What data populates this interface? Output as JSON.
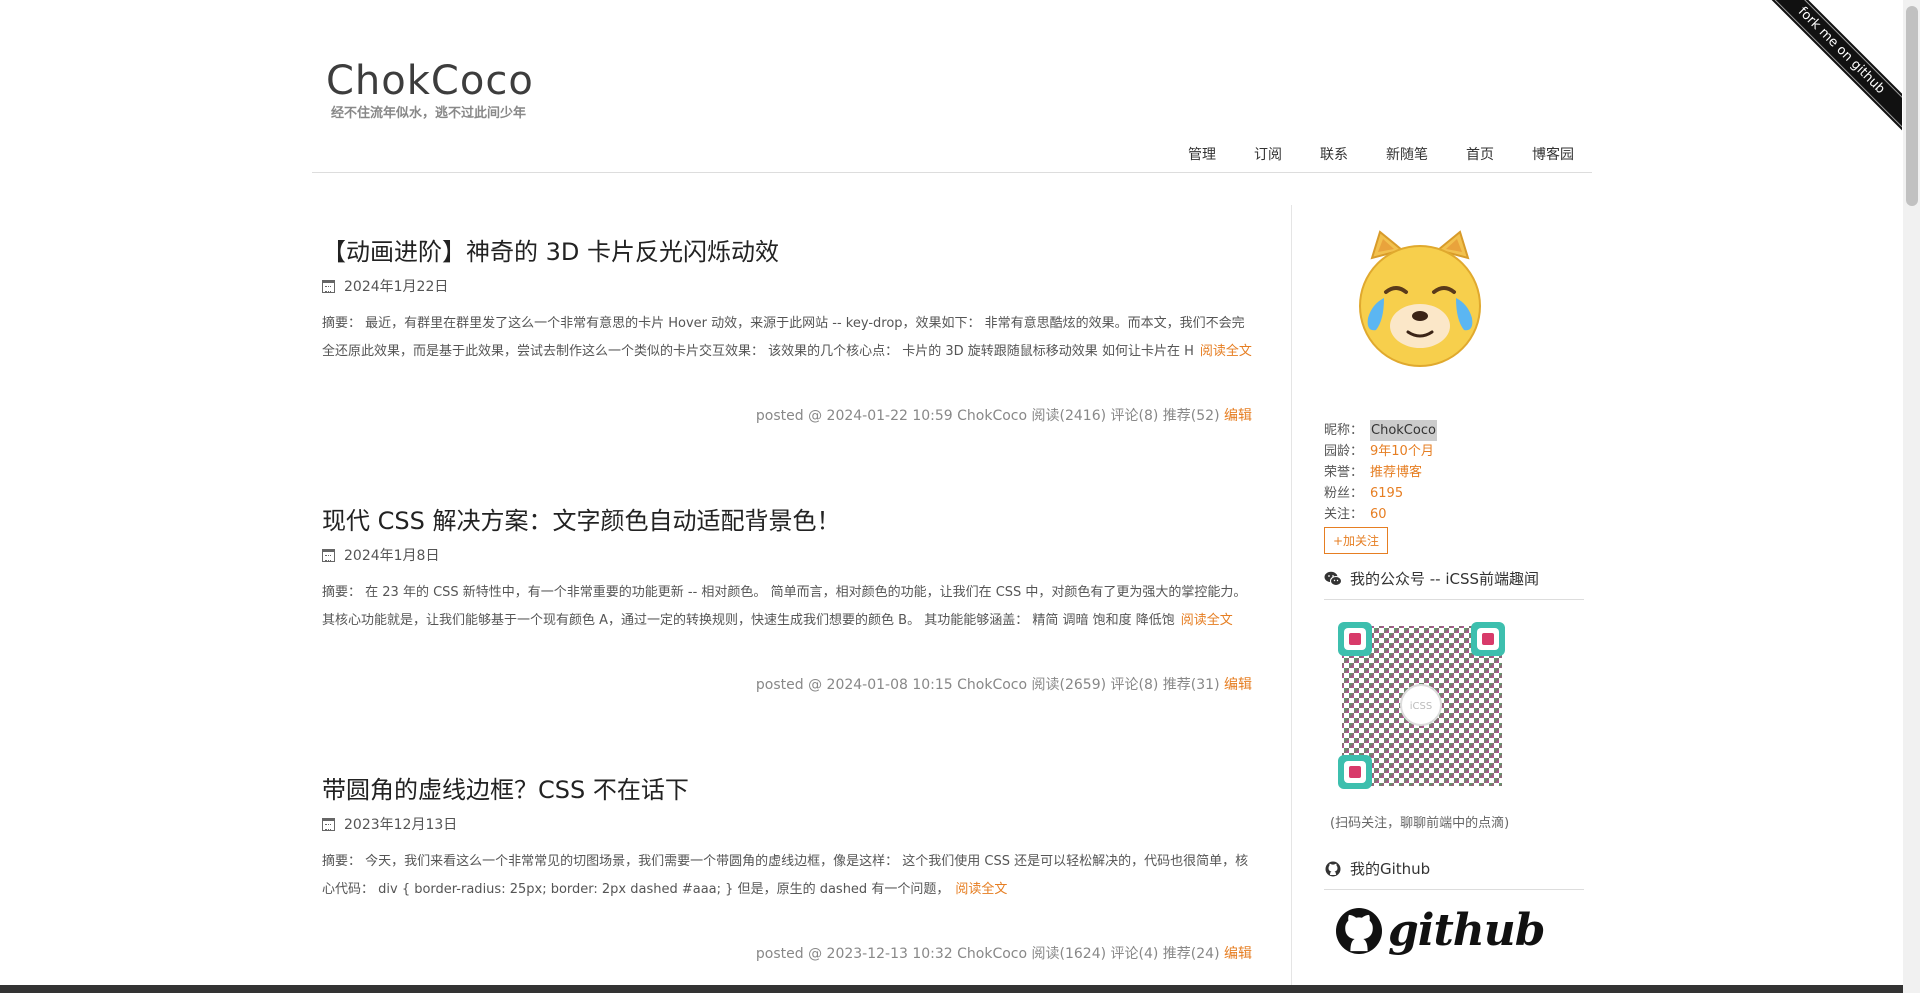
{
  "header": {
    "title": "ChokCoco",
    "subtitle": "经不住流年似水，逃不过此间少年",
    "nav": [
      "管理",
      "订阅",
      "联系",
      "新随笔",
      "首页",
      "博客园"
    ],
    "ribbon": "fork me on github"
  },
  "posts": [
    {
      "title": "【动画进阶】神奇的 3D 卡片反光闪烁动效",
      "date": "2024年1月22日",
      "summary": "摘要： 最近，有群里在群里发了这么一个非常有意思的卡片 Hover 动效，来源于此网站 -- key-drop，效果如下： 非常有意思酷炫的效果。而本文，我们不会完全还原此效果，而是基于此效果，尝试去制作这么一个类似的卡片交互效果： 该效果的几个核心点： 卡片的 3D 旋转跟随鼠标移动效果 如何让卡片在 H",
      "read_more": "阅读全文",
      "footer": "posted @ 2024-01-22 10:59 ChokCoco 阅读(2416) 评论(8) 推荐(52)",
      "edit": "编辑"
    },
    {
      "title": "现代 CSS 解决方案：文字颜色自动适配背景色！",
      "date": "2024年1月8日",
      "summary": "摘要： 在 23 年的 CSS 新特性中，有一个非常重要的功能更新 -- 相对颜色。 简单而言，相对颜色的功能，让我们在 CSS 中，对颜色有了更为强大的掌控能力。 其核心功能就是，让我们能够基于一个现有颜色 A，通过一定的转换规则，快速生成我们想要的颜色 B。 其功能能够涵盖： 精简 调暗 饱和度 降低饱",
      "read_more": "阅读全文",
      "footer": "posted @ 2024-01-08 10:15 ChokCoco 阅读(2659) 评论(8) 推荐(31)",
      "edit": "编辑"
    },
    {
      "title": "带圆角的虚线边框？CSS 不在话下",
      "date": "2023年12月13日",
      "summary": "摘要： 今天，我们来看这么一个非常常见的切图场景，我们需要一个带圆角的虚线边框，像是这样： 这个我们使用 CSS 还是可以轻松解决的，代码也很简单，核心代码： div { border-radius: 25px; border: 2px dashed #aaa; } 但是，原生的 dashed 有一个问题，",
      "read_more": "阅读全文",
      "footer": "posted @ 2023-12-13 10:32 ChokCoco 阅读(1624) 评论(4) 推荐(24)",
      "edit": "编辑"
    }
  ],
  "sidebar": {
    "profile": {
      "nick_k": "昵称：",
      "nick_v": "ChokCoco",
      "age_k": "园龄：",
      "age_v": "9年10个月",
      "honor_k": "荣誉：",
      "honor_v": "推荐博客",
      "fans_k": "粉丝：",
      "fans_v": "6195",
      "follow_k": "关注：",
      "follow_v": "60"
    },
    "follow_btn": "+加关注",
    "wechat_title": "我的公众号 -- iCSS前端趣闻",
    "qr_caption": "(扫码关注，聊聊前端中的点滴)",
    "github_title": "我的Github",
    "github_word": "github"
  }
}
